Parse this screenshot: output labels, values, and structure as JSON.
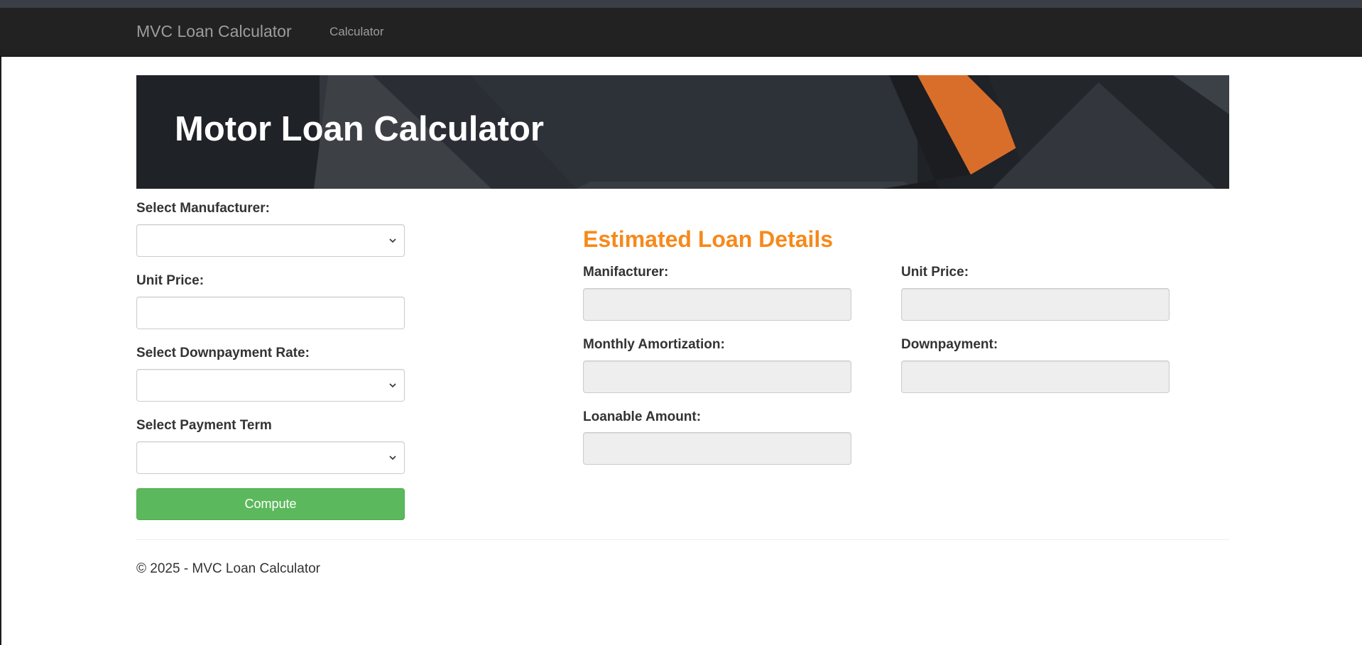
{
  "navbar": {
    "brand": "MVC Loan Calculator",
    "links": [
      "Calculator"
    ]
  },
  "hero": {
    "title": "Motor Loan Calculator"
  },
  "form": {
    "manufacturer_label": "Select Manufacturer:",
    "manufacturer_value": "",
    "unit_price_label": "Unit Price:",
    "unit_price_value": "",
    "downpayment_rate_label": "Select Downpayment Rate:",
    "downpayment_rate_value": "",
    "payment_term_label": "Select Payment Term",
    "payment_term_value": "",
    "compute_label": "Compute"
  },
  "results": {
    "title": "Estimated Loan Details",
    "manufacturer_label": "Manifacturer:",
    "manufacturer_value": "",
    "unit_price_label": "Unit Price:",
    "unit_price_value": "",
    "monthly_amortization_label": "Monthly Amortization:",
    "monthly_amortization_value": "",
    "downpayment_label": "Downpayment:",
    "downpayment_value": "",
    "loanable_amount_label": "Loanable Amount:",
    "loanable_amount_value": ""
  },
  "footer": {
    "text": "© 2025 - MVC Loan Calculator"
  },
  "colors": {
    "navbar_bg": "#222222",
    "accent_orange": "#f7891b",
    "compute_green": "#5cb85c",
    "readonly_bg": "#eeeeee"
  },
  "icons": {
    "select_arrow": "chevron-down-icon"
  }
}
